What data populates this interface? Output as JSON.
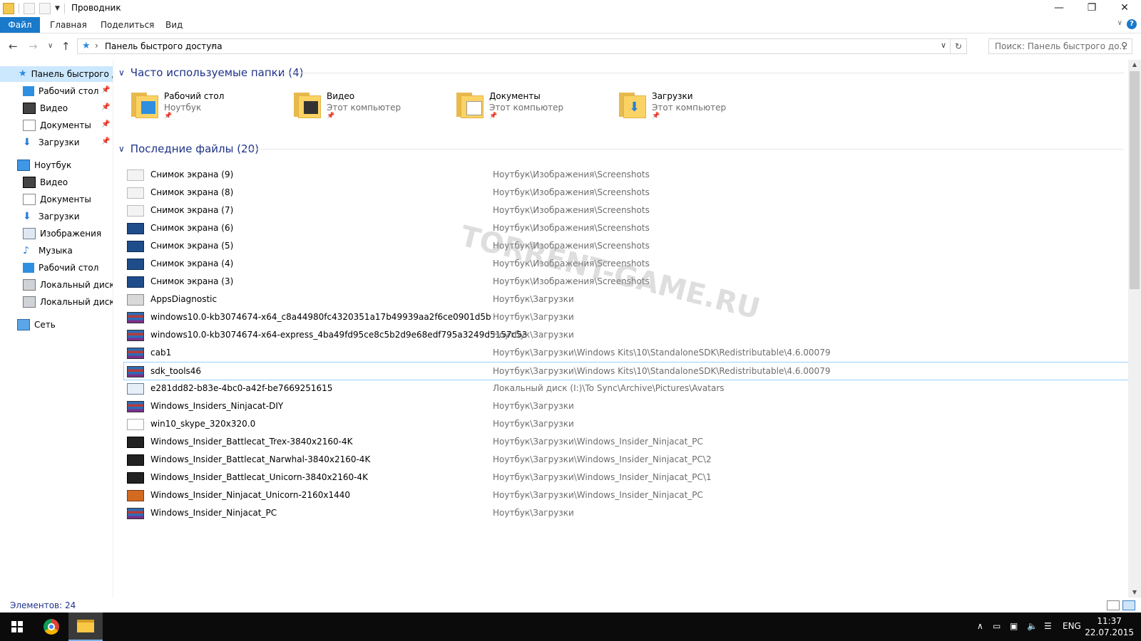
{
  "window": {
    "title": "Проводник",
    "controls": {
      "minimize": "—",
      "maximize": "❐",
      "close": "✕"
    }
  },
  "ribbon": {
    "tabs": [
      "Файл",
      "Главная",
      "Поделиться",
      "Вид"
    ],
    "help": "?"
  },
  "address": {
    "path": "Панель быстрого доступа",
    "search_placeholder": "Поиск: Панель быстрого до..."
  },
  "sidebar": {
    "quick_access": "Панель быстрого до",
    "pinned": [
      "Рабочий стол",
      "Видео",
      "Документы",
      "Загрузки"
    ],
    "computer": "Ноутбук",
    "computer_items": [
      "Видео",
      "Документы",
      "Загрузки",
      "Изображения",
      "Музыка",
      "Рабочий стол",
      "Локальный диск (С",
      "Локальный диск (I:"
    ],
    "network": "Сеть"
  },
  "frequent": {
    "header": "Часто используемые папки (4)",
    "folders": [
      {
        "name": "Рабочий стол",
        "sub": "Ноутбук"
      },
      {
        "name": "Видео",
        "sub": "Этот компьютер"
      },
      {
        "name": "Документы",
        "sub": "Этот компьютер"
      },
      {
        "name": "Загрузки",
        "sub": "Этот компьютер"
      }
    ]
  },
  "recent": {
    "header": "Последние файлы (20)",
    "files": [
      {
        "name": "Снимок экрана (9)",
        "path": "Ноутбук\\Изображения\\Screenshots",
        "icon": "shot-w"
      },
      {
        "name": "Снимок экрана (8)",
        "path": "Ноутбук\\Изображения\\Screenshots",
        "icon": "shot-w"
      },
      {
        "name": "Снимок экрана (7)",
        "path": "Ноутбук\\Изображения\\Screenshots",
        "icon": "shot-w"
      },
      {
        "name": "Снимок экрана (6)",
        "path": "Ноутбук\\Изображения\\Screenshots",
        "icon": "shot-d"
      },
      {
        "name": "Снимок экрана (5)",
        "path": "Ноутбук\\Изображения\\Screenshots",
        "icon": "shot-d"
      },
      {
        "name": "Снимок экрана (4)",
        "path": "Ноутбук\\Изображения\\Screenshots",
        "icon": "shot-d"
      },
      {
        "name": "Снимок экрана (3)",
        "path": "Ноутбук\\Изображения\\Screenshots",
        "icon": "shot-d"
      },
      {
        "name": "AppsDiagnostic",
        "path": "Ноутбук\\Загрузки",
        "icon": "app"
      },
      {
        "name": "windows10.0-kb3074674-x64_c8a44980fc4320351a17b49939aa2f6ce0901d5b",
        "path": "Ноутбук\\Загрузки",
        "icon": "rar"
      },
      {
        "name": "windows10.0-kb3074674-x64-express_4ba49fd95ce8c5b2d9e68edf795a3249d5157c53",
        "path": "Ноутбук\\Загрузки",
        "icon": "rar"
      },
      {
        "name": "cab1",
        "path": "Ноутбук\\Загрузки\\Windows Kits\\10\\StandaloneSDK\\Redistributable\\4.6.00079",
        "icon": "rar"
      },
      {
        "name": "sdk_tools46",
        "path": "Ноутбук\\Загрузки\\Windows Kits\\10\\StandaloneSDK\\Redistributable\\4.6.00079",
        "icon": "rar"
      },
      {
        "name": "e281dd82-b83e-4bc0-a42f-be7669251615",
        "path": "Локальный диск (I:)\\To Sync\\Archive\\Pictures\\Avatars",
        "icon": "avatar"
      },
      {
        "name": "Windows_Insiders_Ninjacat-DIY",
        "path": "Ноутбук\\Загрузки",
        "icon": "rar"
      },
      {
        "name": "win10_skype_320x320.0",
        "path": "Ноутбук\\Загрузки",
        "icon": "img"
      },
      {
        "name": "Windows_Insider_Battlecat_Trex-3840x2160-4K",
        "path": "Ноутбук\\Загрузки\\Windows_Insider_Ninjacat_PC",
        "icon": "dark"
      },
      {
        "name": "Windows_Insider_Battlecat_Narwhal-3840x2160-4K",
        "path": "Ноутбук\\Загрузки\\Windows_Insider_Ninjacat_PC\\2",
        "icon": "dark"
      },
      {
        "name": "Windows_Insider_Battlecat_Unicorn-3840x2160-4K",
        "path": "Ноутбук\\Загрузки\\Windows_Insider_Ninjacat_PC\\1",
        "icon": "dark"
      },
      {
        "name": "Windows_Insider_Ninjacat_Unicorn-2160x1440",
        "path": "Ноутбук\\Загрузки\\Windows_Insider_Ninjacat_PC",
        "icon": "orange"
      },
      {
        "name": "Windows_Insider_Ninjacat_PC",
        "path": "Ноутбук\\Загрузки",
        "icon": "rar"
      }
    ],
    "selected_index": 11
  },
  "status": {
    "count": "Элементов: 24"
  },
  "taskbar": {
    "lang": "ENG",
    "time": "11:37",
    "date": "22.07.2015"
  },
  "watermark": "TORRENT-GAME.RU"
}
